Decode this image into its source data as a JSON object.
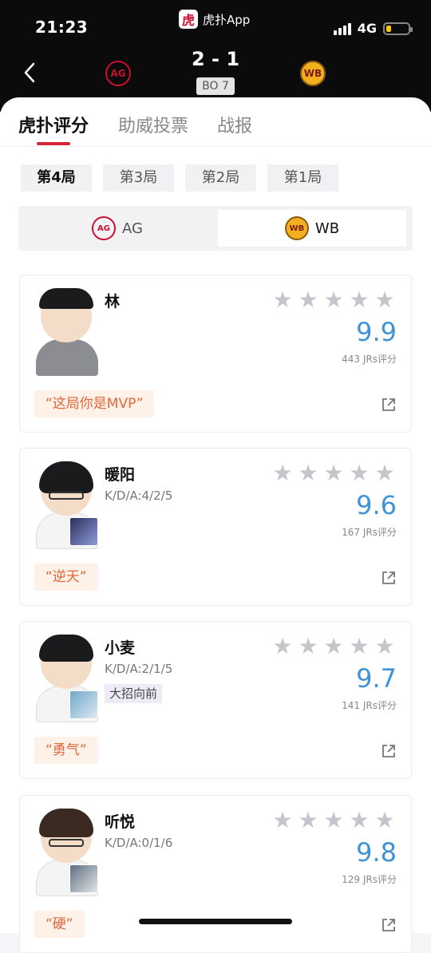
{
  "status_bar": {
    "time": "21:23",
    "network": "4G"
  },
  "app": {
    "logo_char": "虎",
    "name": "虎扑App"
  },
  "match": {
    "score": "2 - 1",
    "format": "BO 7",
    "team_left_logo": "AG",
    "team_right_logo": "WB"
  },
  "tabs": [
    "虎扑评分",
    "助威投票",
    "战报"
  ],
  "games": [
    "第4局",
    "第3局",
    "第2局",
    "第1局"
  ],
  "team_toggle": [
    {
      "logo": "AG",
      "name": "AG"
    },
    {
      "logo": "WB",
      "name": "WB"
    }
  ],
  "players": [
    {
      "name": "林",
      "kda": "",
      "tag": "",
      "rating": "9.9",
      "jrs": "443 JRs评分",
      "comment": "“这局你是MVP”"
    },
    {
      "name": "暖阳",
      "kda": "K/D/A:4/2/5",
      "tag": "",
      "rating": "9.6",
      "jrs": "167 JRs评分",
      "comment": "“逆天”"
    },
    {
      "name": "小麦",
      "kda": "K/D/A:2/1/5",
      "tag": "大招向前",
      "rating": "9.7",
      "jrs": "141 JRs评分",
      "comment": "“勇气”"
    },
    {
      "name": "听悦",
      "kda": "K/D/A:0/1/6",
      "tag": "",
      "rating": "9.8",
      "jrs": "129 JRs评分",
      "comment": "“硬”"
    }
  ],
  "star_glyph": "★",
  "colors": {
    "accent": "#d6243a",
    "rating": "#3f93d6",
    "comment": "#e0663b"
  }
}
